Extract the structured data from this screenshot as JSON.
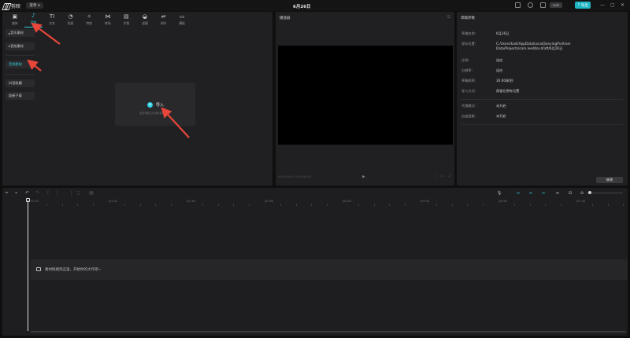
{
  "app": {
    "name": "剪映",
    "menu_label": "菜单",
    "project_title": "6月26日"
  },
  "titlebar": {
    "pro_badge": "SVIP",
    "export_label": "导出"
  },
  "media": {
    "tabs": [
      {
        "label": "媒体",
        "icon": "media-icon",
        "glyph": "▣"
      },
      {
        "label": "音频",
        "icon": "audio-icon",
        "glyph": "♪"
      },
      {
        "label": "文本",
        "icon": "text-icon",
        "glyph": "TI"
      },
      {
        "label": "贴纸",
        "icon": "sticker-icon",
        "glyph": "◔"
      },
      {
        "label": "特效",
        "icon": "effects-icon",
        "glyph": "✧"
      },
      {
        "label": "转场",
        "icon": "transition-icon",
        "glyph": "⋈"
      },
      {
        "label": "字幕",
        "icon": "caption-icon",
        "glyph": "▤"
      },
      {
        "label": "滤镜",
        "icon": "filter-icon",
        "glyph": "◒"
      },
      {
        "label": "调节",
        "icon": "adjust-icon",
        "glyph": "⇌"
      },
      {
        "label": "模板",
        "icon": "template-icon",
        "glyph": "▭"
      }
    ],
    "active_tab": 1,
    "side_nav": [
      "音乐素材",
      "音效素材",
      "音频提取",
      "抖音收藏",
      "链接下载"
    ],
    "active_side": 2,
    "import_label": "导入",
    "import_hint": "支持视频文件提取音频"
  },
  "player": {
    "title": "播放器",
    "time": "00:00:00:00 / 00:00:00:00"
  },
  "params": {
    "title": "草稿参数",
    "rows": [
      {
        "label": "草稿名称:",
        "value": "6月26日"
      },
      {
        "label": "保存位置:",
        "value": "C:/Users/kaili/AppData/Local/JianyingPro/User Data/Projects/com.lveditor.draft/6月26日"
      },
      {
        "label": "比例:",
        "value": "适应"
      },
      {
        "label": "分辨率:",
        "value": "适应"
      },
      {
        "label": "草稿帧率:",
        "value": "30.00帧/秒"
      },
      {
        "label": "导入方式:",
        "value": "保留在原有位置"
      },
      {
        "label": "代理模式:",
        "value": "未开启"
      },
      {
        "label": "自由层级:",
        "value": "未开启"
      }
    ],
    "modify_label": "修改"
  },
  "timeline": {
    "ruler": [
      "00:00",
      "|01:00",
      "|02:00",
      "|03:00",
      "|04:00",
      "|05:00",
      "|06:00",
      "|07:00"
    ],
    "track_hint": "素材拖拽到这里，开始你的大作吧~"
  },
  "colors": {
    "accent": "#2ecfe0",
    "annotation": "#e8463a",
    "export": "#1fb5c4"
  }
}
